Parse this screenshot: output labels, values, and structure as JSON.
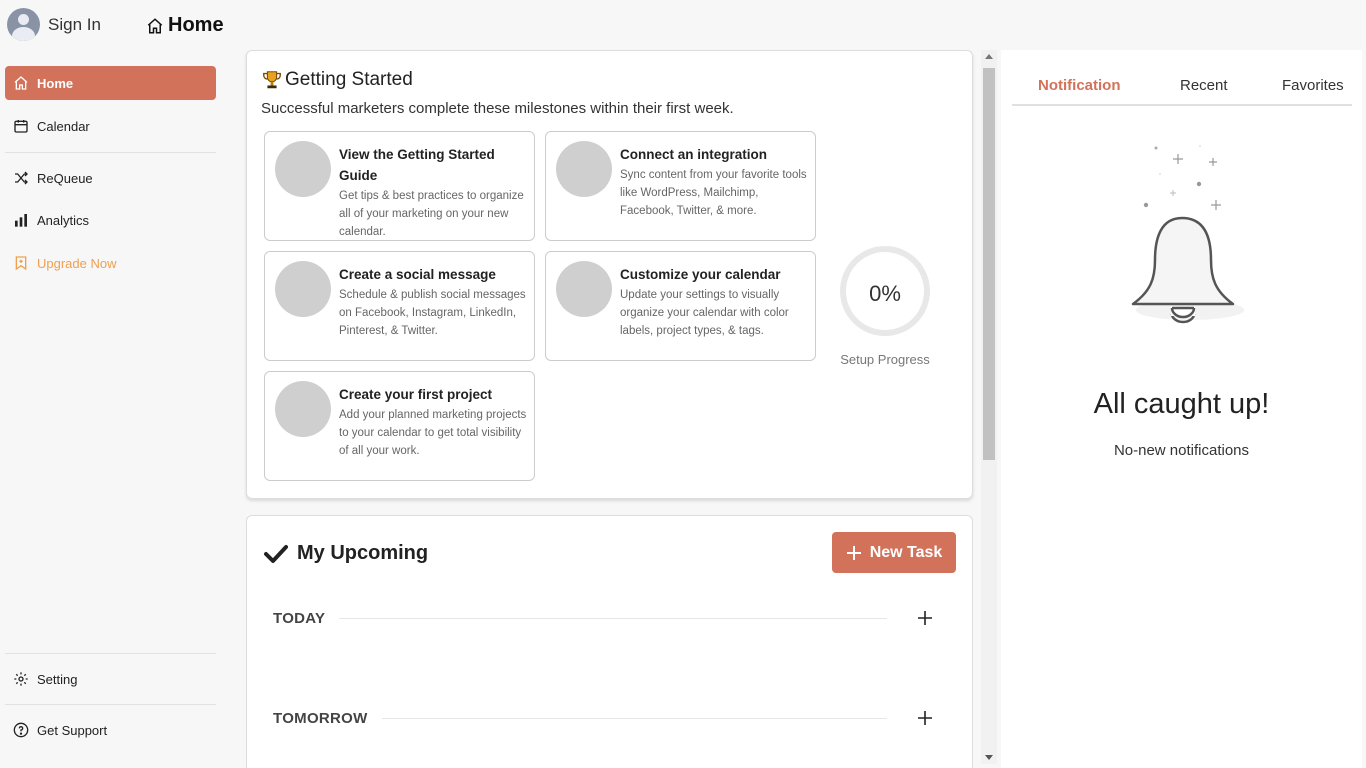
{
  "topbar": {
    "signin_label": "Sign In",
    "page_title": "Home"
  },
  "sidebar": {
    "items": [
      {
        "label": "Home",
        "icon": "home-icon",
        "active": true
      },
      {
        "label": "Calendar",
        "icon": "calendar-icon"
      },
      {
        "label": "ReQueue",
        "icon": "shuffle-icon"
      },
      {
        "label": "Analytics",
        "icon": "bar-chart-icon"
      },
      {
        "label": "Upgrade Now",
        "icon": "bookmark-icon"
      }
    ],
    "bottom_items": [
      {
        "label": "Setting",
        "icon": "gear-icon"
      },
      {
        "label": "Get Support",
        "icon": "help-icon"
      }
    ]
  },
  "getting_started": {
    "title": "Getting Started",
    "subtitle": "Successful marketers complete these milestones within their first week.",
    "cards": [
      {
        "title": "View the Getting Started Guide",
        "description": "Get tips & best practices to organize all of your marketing on your new calendar."
      },
      {
        "title": "Connect an integration",
        "description": "Sync content from your favorite tools like WordPress, Mailchimp, Facebook, Twitter, & more."
      },
      {
        "title": "Create a social message",
        "description": "Schedule & publish social messages on Facebook, Instagram, LinkedIn, Pinterest, & Twitter."
      },
      {
        "title": "Customize your calendar",
        "description": "Update your settings to visually organize your calendar with color labels, project types, & tags."
      },
      {
        "title": "Create your first project",
        "description": "Add your planned marketing projects to your calendar to get total visibility of all your work."
      }
    ],
    "progress_value": 0,
    "progress_text": "0%",
    "progress_label": "Setup Progress"
  },
  "upcoming": {
    "title": "My Upcoming",
    "new_task_label": "New Task",
    "days": [
      {
        "label": "TODAY"
      },
      {
        "label": "TOMORROW"
      }
    ]
  },
  "notifications": {
    "tabs": [
      {
        "label": "Notification",
        "active": true
      },
      {
        "label": "Recent"
      },
      {
        "label": "Favorites"
      }
    ],
    "empty_title": "All caught up!",
    "empty_subtitle": "No-new notifications"
  },
  "colors": {
    "accent": "#d2725a",
    "upgrade": "#f0a04b",
    "sidebar_bg": "#f7f7f7"
  }
}
